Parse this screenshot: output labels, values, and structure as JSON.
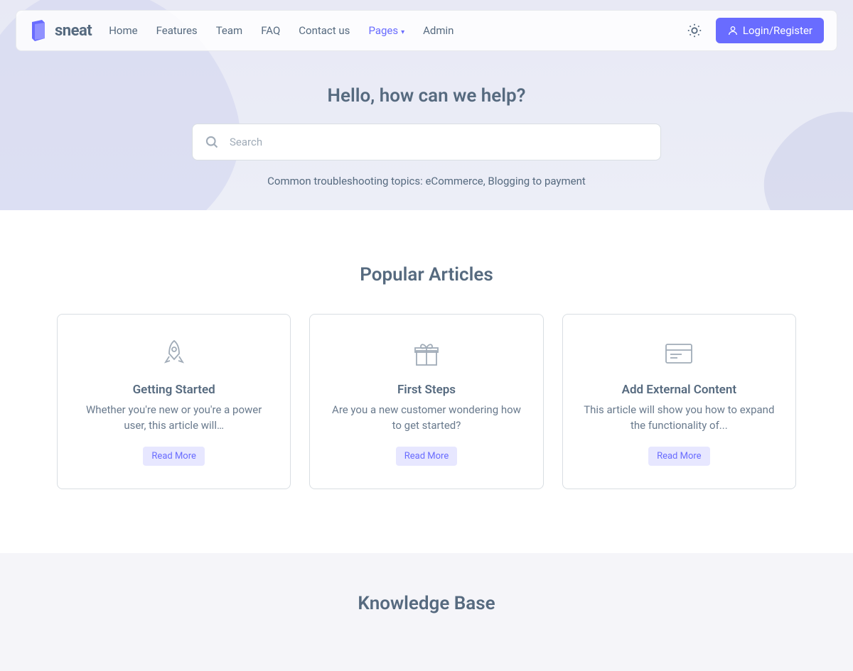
{
  "brand": {
    "name": "sneat"
  },
  "nav": {
    "links": [
      "Home",
      "Features",
      "Team",
      "FAQ",
      "Contact us",
      "Pages",
      "Admin"
    ],
    "active_index": 5,
    "login_label": "Login/Register"
  },
  "hero": {
    "title": "Hello, how can we help?",
    "search_placeholder": "Search",
    "hint": "Common troubleshooting topics: eCommerce, Blogging to payment"
  },
  "popular": {
    "title": "Popular Articles",
    "articles": [
      {
        "title": "Getting Started",
        "desc": "Whether you're new or you're a power user, this article will…",
        "cta": "Read More"
      },
      {
        "title": "First Steps",
        "desc": "Are you a new customer wondering how to get started?",
        "cta": "Read More"
      },
      {
        "title": "Add External Content",
        "desc": "This article will show you how to expand the functionality of...",
        "cta": "Read More"
      }
    ]
  },
  "knowledge": {
    "title": "Knowledge Base"
  }
}
